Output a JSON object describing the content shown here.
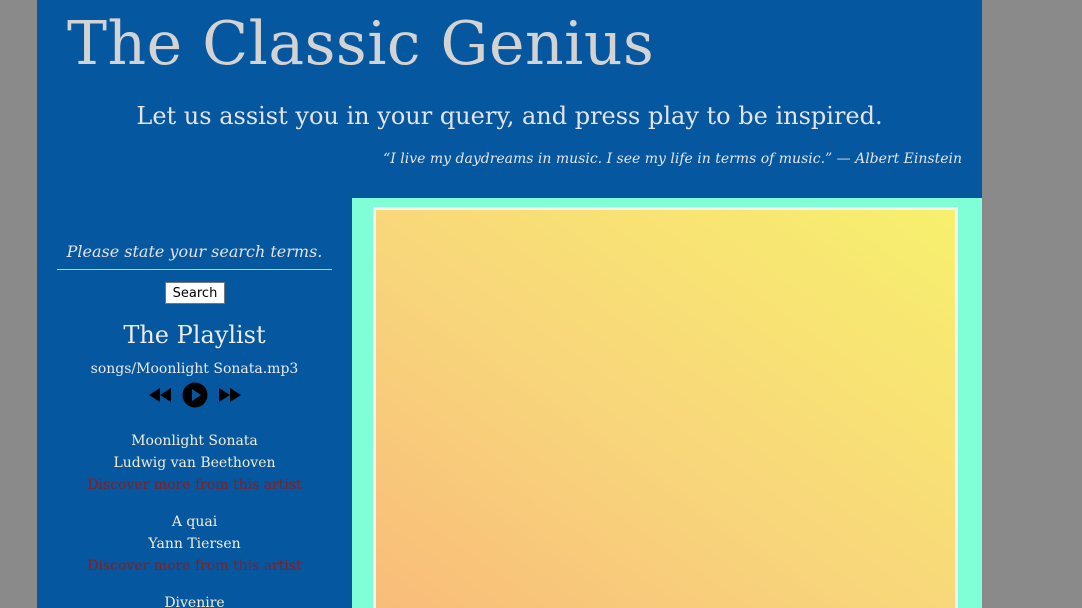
{
  "header": {
    "title": "The Classic Genius",
    "tagline": "Let us assist you in your query, and press play to be inspired.",
    "quote": "“I live my daydreams in music. I see my life in terms of music.” — Albert Einstein"
  },
  "search": {
    "placeholder": "Please state your search terms.",
    "button_label": "Search"
  },
  "playlist": {
    "heading": "The Playlist",
    "now_playing": "songs/Moonlight Sonata.mp3",
    "controls": [
      {
        "name": "rewind",
        "icon": "rewind-icon"
      },
      {
        "name": "play",
        "icon": "play-icon"
      },
      {
        "name": "fast-forward",
        "icon": "fast-forward-icon"
      }
    ],
    "songs": [
      {
        "title": "Moonlight Sonata",
        "artist": "Ludwig van Beethoven",
        "link": "Discover more from this artist"
      },
      {
        "title": "A quai",
        "artist": "Yann Tiersen",
        "link": "Discover more from this artist"
      },
      {
        "title": "Divenire",
        "artist": "",
        "link": ""
      }
    ]
  },
  "colors": {
    "page_background": "#0557a0",
    "outer_background": "#8a8a8a",
    "art_frame": "#80ffd6",
    "link": "#8a1c1c",
    "gradient_start": "#f9bb7a",
    "gradient_end": "#f7f06d"
  }
}
